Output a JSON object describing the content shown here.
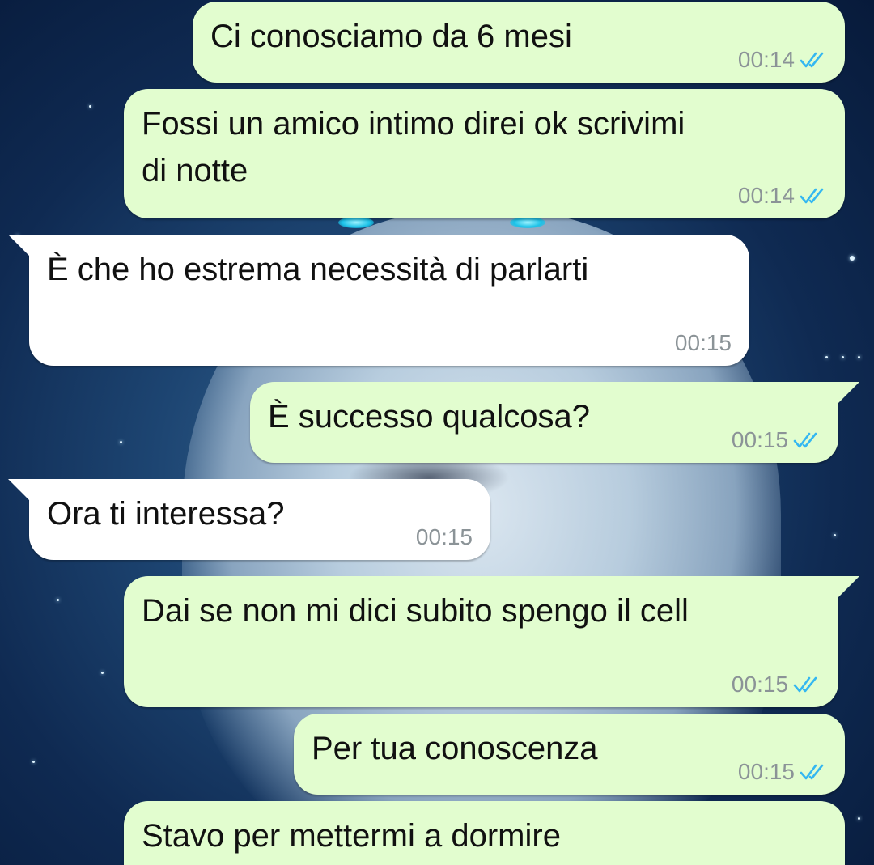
{
  "colors": {
    "outgoing_bubble": "#e2fdcf",
    "incoming_bubble": "#ffffff",
    "read_ticks": "#34b7f1",
    "timestamp": "#8b9397"
  },
  "wallpaper": "wolf-in-space-wallpaper",
  "messages": [
    {
      "direction": "out",
      "text": "Ci conosciamo da 6 mesi",
      "time": "00:14",
      "status": "read-double-check-icon"
    },
    {
      "direction": "out",
      "text": "Fossi un amico intimo direi ok scrivimi di notte",
      "time": "00:14",
      "status": "read-double-check-icon"
    },
    {
      "direction": "in",
      "text": "È che ho estrema necessità di parlarti",
      "time": "00:15"
    },
    {
      "direction": "out",
      "text": "È successo qualcosa?",
      "time": "00:15",
      "status": "read-double-check-icon"
    },
    {
      "direction": "in",
      "text": "Ora ti interessa?",
      "time": "00:15"
    },
    {
      "direction": "out",
      "text": "Dai se non mi dici subito spengo il cell",
      "time": "00:15",
      "status": "read-double-check-icon"
    },
    {
      "direction": "out",
      "text": "Per tua conoscenza",
      "time": "00:15",
      "status": "read-double-check-icon"
    },
    {
      "direction": "out",
      "text": "Stavo per mettermi a dormire",
      "time": "",
      "status": ""
    }
  ]
}
